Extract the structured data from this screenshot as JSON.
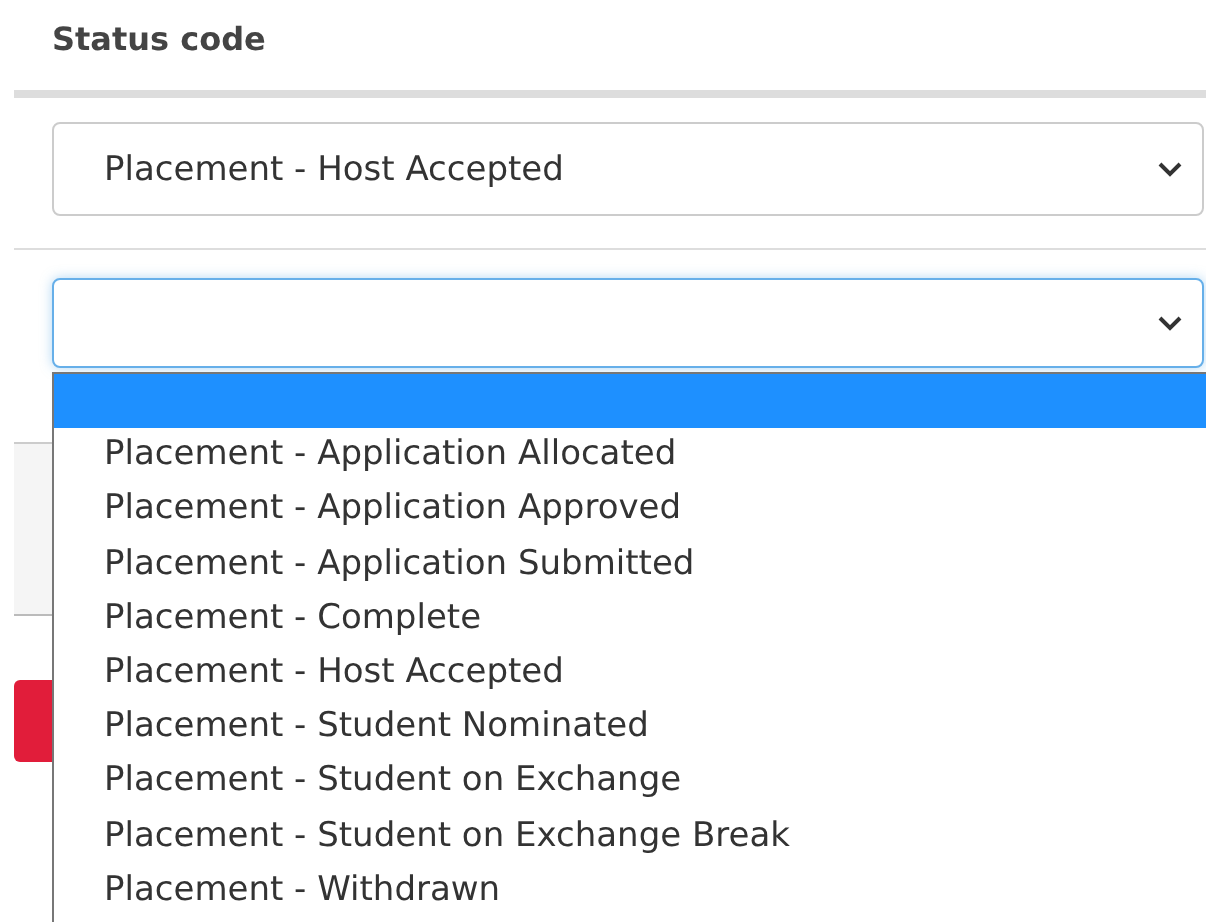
{
  "heading": "Status code",
  "status_select": {
    "value": "Placement - Host Accepted"
  },
  "second_select": {
    "open": true,
    "focused": true
  },
  "options": [
    {
      "selected": true
    },
    {
      "label": "Placement - Application Allocated",
      "selected": false
    },
    {
      "label": "Placement - Application Approved",
      "selected": false
    },
    {
      "label": "Placement - Application Submitted",
      "selected": false
    },
    {
      "label": "Placement - Complete",
      "selected": false
    },
    {
      "label": "Placement - Host Accepted",
      "selected": false
    },
    {
      "label": "Placement - Student Nominated",
      "selected": false
    },
    {
      "label": "Placement - Student on Exchange",
      "selected": false
    },
    {
      "label": "Placement - Student on Exchange Break",
      "selected": false
    },
    {
      "label": "Placement - Withdrawn",
      "selected": false
    }
  ]
}
